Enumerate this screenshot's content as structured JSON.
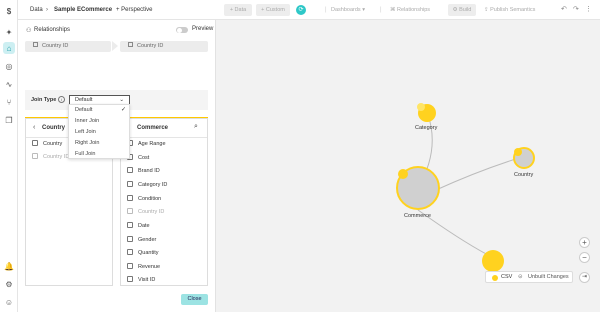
{
  "sidebar": {
    "icons": [
      "spark-icon",
      "network-icon",
      "compass-icon",
      "pulse-icon",
      "branch-icon",
      "layers-icon",
      "bell-icon",
      "gear-icon",
      "user-icon"
    ]
  },
  "breadcrumb": {
    "root": "Data",
    "current": "Sample ECommerce",
    "add": "+ Perspective"
  },
  "toolbar": {
    "data": "+ Data",
    "custom": "+ Custom",
    "dashboards": "Dashboards",
    "relationships": "Relationships",
    "build": "Build",
    "publish": "Publish Semantics"
  },
  "panel": {
    "title": "Relationships",
    "preview": "Preview",
    "left_field": "Country ID",
    "right_field": "Country ID",
    "join_type_label": "Join Type",
    "join_type_value": "Default",
    "join_options": [
      "Default",
      "Inner Join",
      "Left Join",
      "Right Join",
      "Full Join"
    ],
    "left_table": {
      "name": "Country",
      "columns": [
        {
          "label": "Country",
          "dim": false
        },
        {
          "label": "Country ID",
          "dim": true
        }
      ]
    },
    "right_table": {
      "name": "Commerce",
      "columns": [
        {
          "label": "Age Range",
          "dim": false
        },
        {
          "label": "Cost",
          "dim": false
        },
        {
          "label": "Brand ID",
          "dim": false
        },
        {
          "label": "Category ID",
          "dim": false
        },
        {
          "label": "Condition",
          "dim": false
        },
        {
          "label": "Country ID",
          "dim": true
        },
        {
          "label": "Date",
          "dim": false
        },
        {
          "label": "Gender",
          "dim": false
        },
        {
          "label": "Quantity",
          "dim": false
        },
        {
          "label": "Revenue",
          "dim": false
        },
        {
          "label": "Visit ID",
          "dim": false
        }
      ]
    },
    "close": "Close"
  },
  "graph": {
    "nodes": [
      "Category",
      "Country",
      "Commerce"
    ]
  },
  "status": {
    "csv": "CSV",
    "unbuilt": "Unbuilt Changes"
  },
  "colors": {
    "accent": "#2ec8c8",
    "node_yellow": "#ffd21f",
    "node_grey": "#d0d0d0",
    "separator": "#ffc800"
  }
}
